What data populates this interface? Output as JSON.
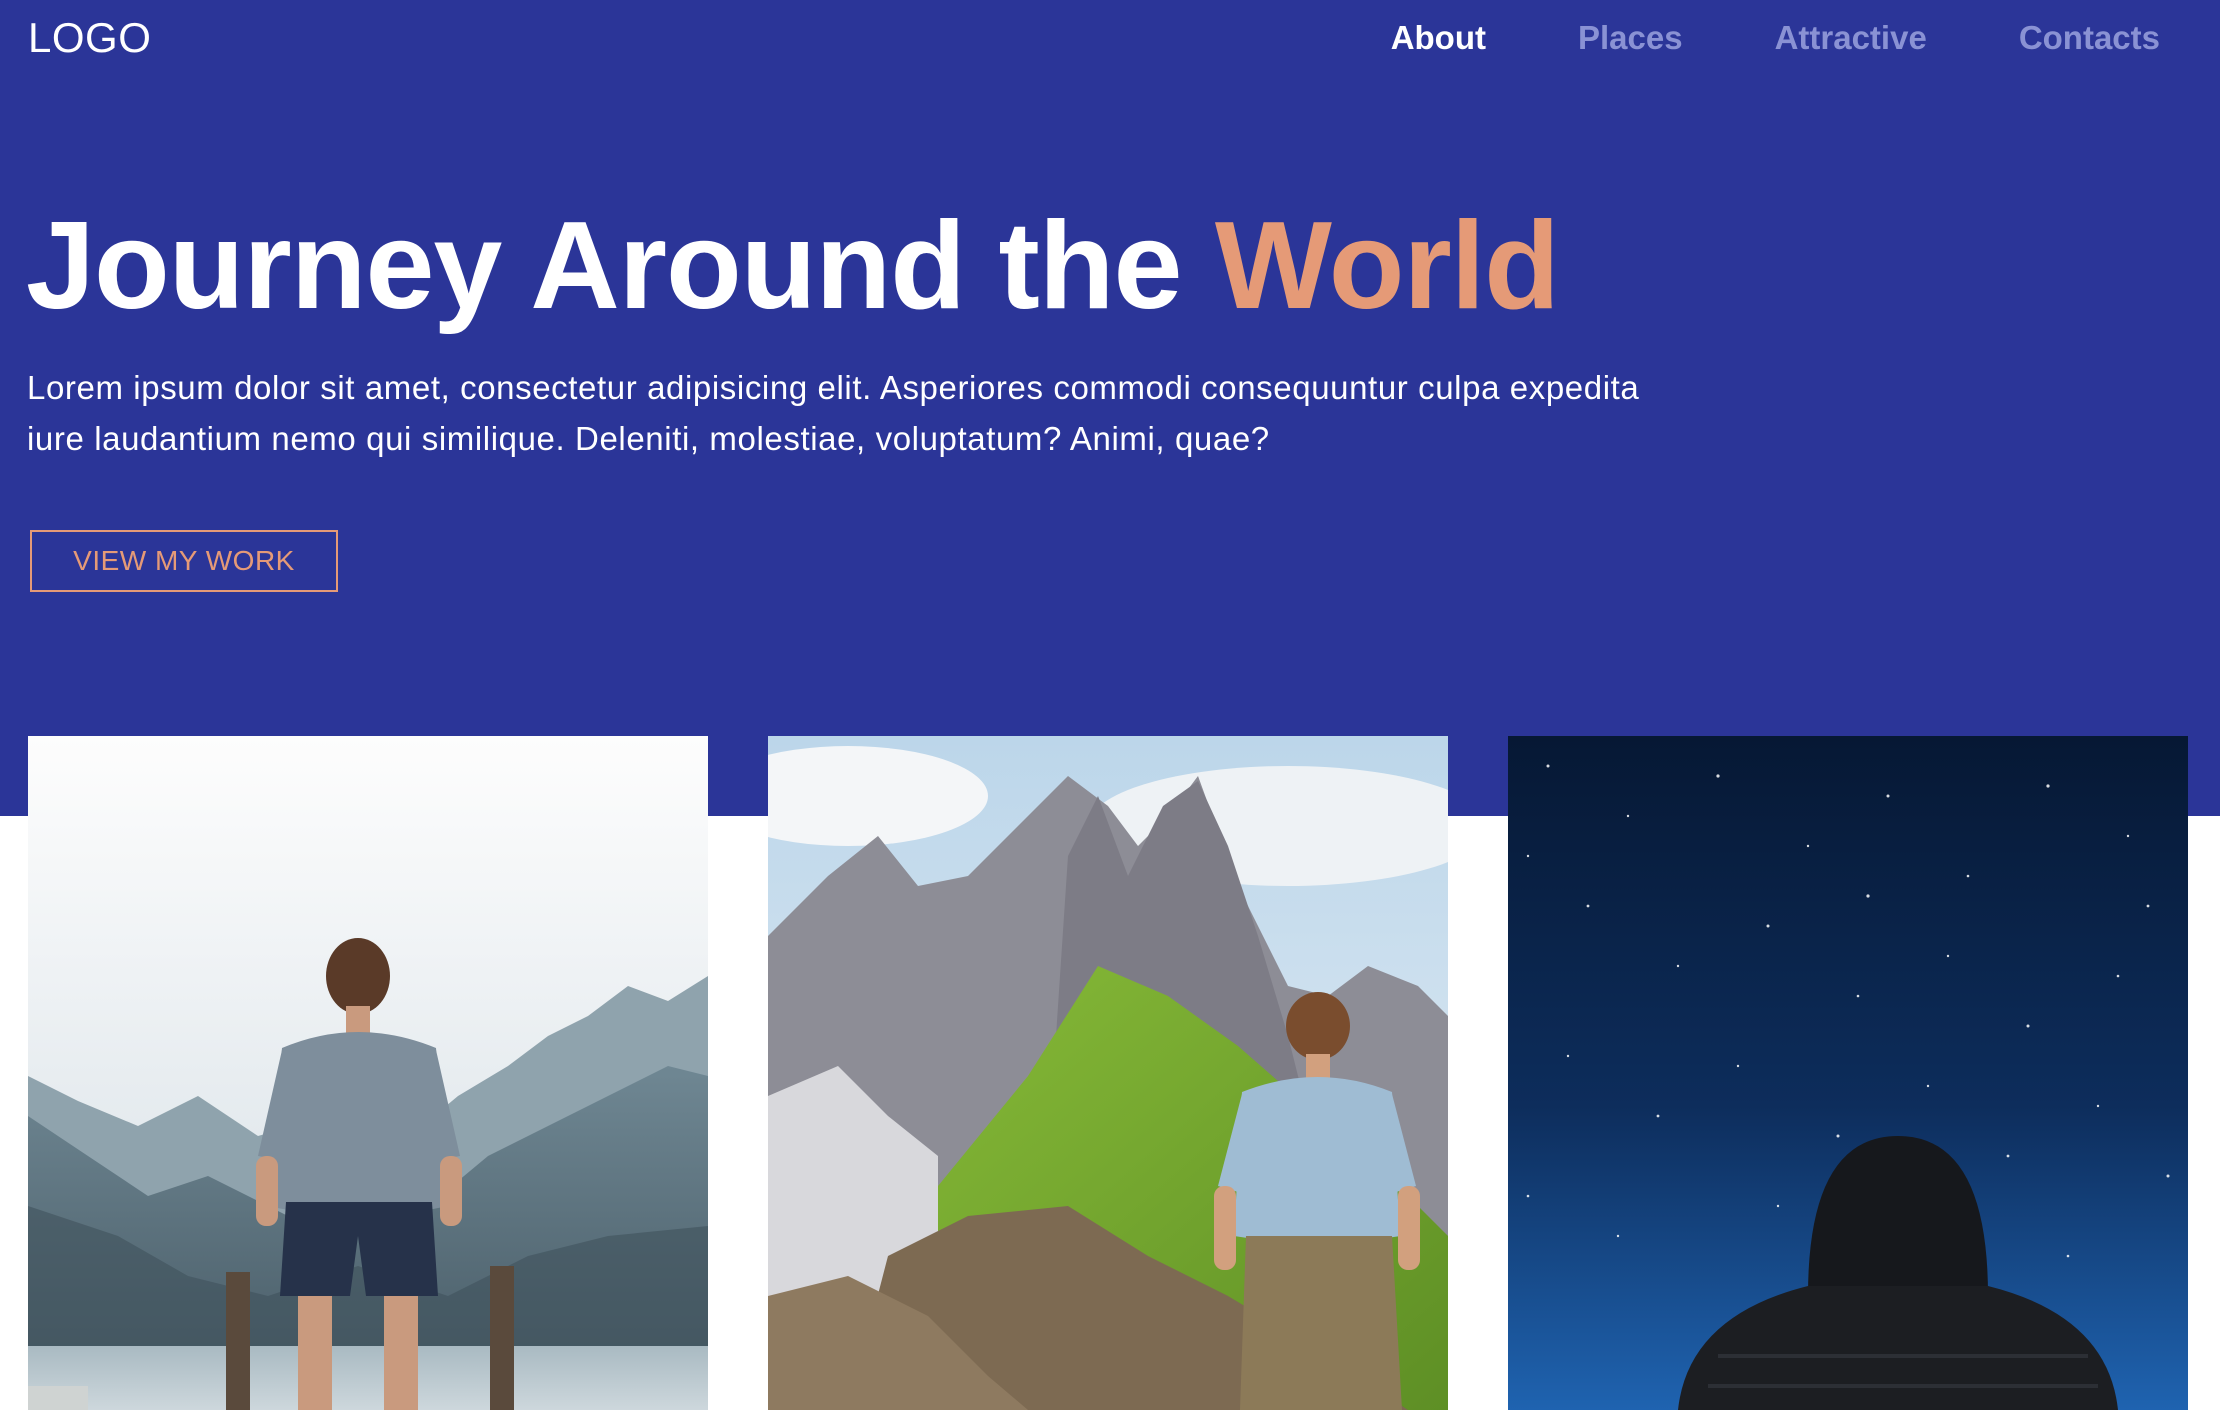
{
  "header": {
    "logo": "LOGO",
    "nav": [
      {
        "label": "About",
        "active": true
      },
      {
        "label": "Places",
        "active": false
      },
      {
        "label": "Attractive",
        "active": false
      },
      {
        "label": "Contacts",
        "active": false
      }
    ]
  },
  "hero": {
    "title_main": "Journey Around the",
    "title_accent": "World",
    "text": "Lorem ipsum dolor sit amet, consectetur adipisicing elit. Asperiores commodi consequuntur culpa expedita iure laudantium nemo qui similique. Deleniti, molestiae, voluptatum? Animi, quae?",
    "cta_label": "VIEW MY WORK"
  },
  "colors": {
    "hero_background": "#2b3598",
    "accent": "#e59a77",
    "nav_inactive": "#8a92d4",
    "text_light": "#ffffff"
  },
  "cards": [
    {
      "image": "traveler-by-mountain-lake-photo"
    },
    {
      "image": "traveler-facing-rocky-peaks-photo"
    },
    {
      "image": "hooded-person-under-night-sky-photo"
    }
  ]
}
